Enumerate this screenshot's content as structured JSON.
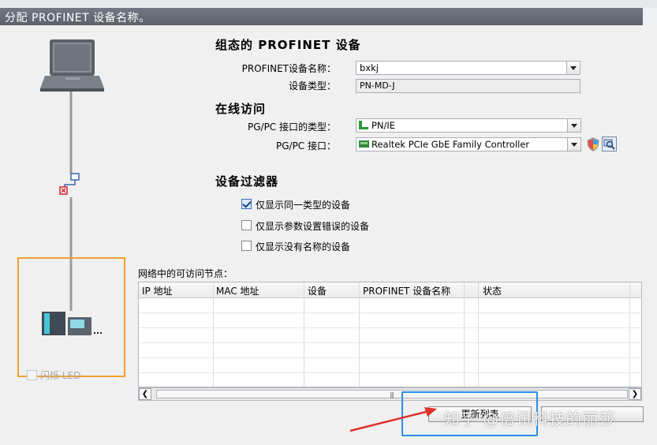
{
  "dialog": {
    "title": "分配 PROFINET 设备名称。"
  },
  "configured_device": {
    "heading": "组态的 PROFINET 设备",
    "name_label": "PROFINET设备名称：",
    "name_value": "bxkj",
    "type_label": "设备类型：",
    "type_value": "PN-MD-J"
  },
  "online_access": {
    "heading": "在线访问",
    "interface_type_label": "PG/PC 接口的类型：",
    "interface_type_value": "PN/IE",
    "interface_label": "PG/PC 接口：",
    "interface_value": "Realtek PCIe GbE Family Controller"
  },
  "device_filter": {
    "heading": "设备过滤器",
    "options": [
      {
        "label": "仅显示同一类型的设备",
        "checked": true
      },
      {
        "label": "仅显示参数设置错误的设备",
        "checked": false
      },
      {
        "label": "仅显示没有名称的设备",
        "checked": false
      }
    ]
  },
  "nodes_table": {
    "caption": "网络中的可访问节点：",
    "columns": [
      "IP 地址",
      "MAC 地址",
      "设备",
      "PROFINET 设备名称",
      "状态"
    ]
  },
  "led": {
    "label": "闪烁 LED",
    "checked": false
  },
  "buttons": {
    "update_list": "更新列表"
  },
  "watermark": "知乎 @倍讯科技的丽莎",
  "colors": {
    "highlight_orange": "#f0a030",
    "highlight_blue": "#2a8de8",
    "arrow_red": "#e0302a"
  }
}
